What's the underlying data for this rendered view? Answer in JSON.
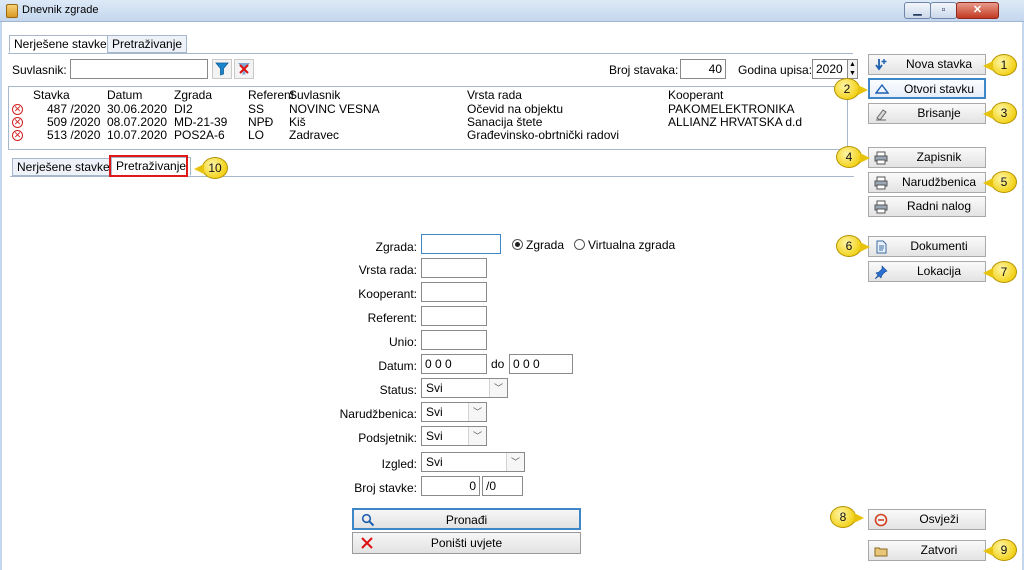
{
  "window": {
    "title": "Dnevnik zgrade"
  },
  "top_tabs": [
    {
      "label": "Nerješene stavke",
      "active": true
    },
    {
      "label": "Pretraživanje",
      "active": false
    }
  ],
  "filter": {
    "suvlasnik_label": "Suvlasnik:",
    "suvlasnik_value": "",
    "broj_stavaka_label": "Broj stavaka:",
    "broj_stavaka_value": "40",
    "godina_upisa_label": "Godina upisa:",
    "godina_upisa_value": "2020"
  },
  "table": {
    "headers": [
      "Stavka",
      "Datum",
      "Zgrada",
      "Referent",
      "Suvlasnik",
      "Vrsta rada",
      "Kooperant"
    ],
    "rows": [
      [
        "487 /2020",
        "30.06.2020",
        "DI2",
        "SS",
        "NOVINC VESNA",
        "Očevid na objektu",
        "PAKOMELEKTRONIKA"
      ],
      [
        "509 /2020",
        "08.07.2020",
        "MD-21-39",
        "NPĐ",
        "Kiš",
        "Sanacija štete",
        "ALLIANZ HRVATSKA d.d"
      ],
      [
        "513 /2020",
        "10.07.2020",
        "POS2A-6",
        "LO",
        "Zadravec",
        "Građevinsko-obrtnički radovi",
        ""
      ]
    ]
  },
  "inner_tabs": [
    {
      "label": "Nerješene stavke",
      "active": false
    },
    {
      "label": "Pretraživanje",
      "active": true
    }
  ],
  "search": {
    "zgrada_label": "Zgrada:",
    "zgrada_value": "",
    "radio_zgrada": "Zgrada",
    "radio_virtualna": "Virtualna zgrada",
    "radio_selected": "zgrada",
    "vrsta_rada_label": "Vrsta rada:",
    "kooperant_label": "Kooperant:",
    "referent_label": "Referent:",
    "unio_label": "Unio:",
    "datum_label": "Datum:",
    "datum_from": "0 0 0",
    "datum_do_label": "do",
    "datum_to": "0 0 0",
    "status_label": "Status:",
    "status_value": "Svi",
    "narudzbenica_label": "Narudžbenica:",
    "narudzbenica_value": "Svi",
    "podsjetnik_label": "Podsjetnik:",
    "podsjetnik_value": "Svi",
    "izgled_label": "Izgled:",
    "izgled_value": "Svi",
    "broj_stavke_label": "Broj stavke:",
    "broj_stavke_value": "0",
    "broj_stavke_year": "/0",
    "pronadi_label": "Pronađi",
    "ponisti_label": "Poništi uvjete"
  },
  "sidebar": {
    "nova_stavka": "Nova stavka",
    "otvori_stavku": "Otvori stavku",
    "brisanje": "Brisanje",
    "zapisnik": "Zapisnik",
    "narudzbenica": "Narudžbenica",
    "radni_nalog": "Radni nalog",
    "dokumenti": "Dokumenti",
    "lokacija": "Lokacija",
    "osvjezi": "Osvježi",
    "zatvori": "Zatvori"
  },
  "callouts": [
    "1",
    "2",
    "3",
    "4",
    "5",
    "6",
    "7",
    "8",
    "9",
    "10"
  ],
  "colors": {
    "highlight_box": "#e01818",
    "callout": "#f2d21b",
    "focus_border": "#3f86c9"
  }
}
